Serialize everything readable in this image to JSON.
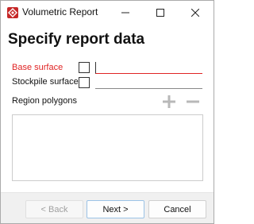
{
  "window": {
    "title": "Volumetric Report",
    "accent_color": "#c62828",
    "icons": {
      "app": "app-logo-icon",
      "minimize": "minimize-icon",
      "maximize": "maximize-icon",
      "close": "close-icon"
    }
  },
  "page": {
    "heading": "Specify report data"
  },
  "form": {
    "base_surface": {
      "label": "Base surface",
      "label_color": "#e02424",
      "checked": false,
      "value": ""
    },
    "stockpile_surface": {
      "label": "Stockpile surface",
      "checked": false,
      "value": ""
    },
    "region_polygons": {
      "label": "Region polygons",
      "add_icon": "plus-icon",
      "remove_icon": "minus-icon",
      "items": []
    }
  },
  "footer": {
    "back_label": "< Back",
    "next_label": "Next >",
    "cancel_label": "Cancel"
  }
}
